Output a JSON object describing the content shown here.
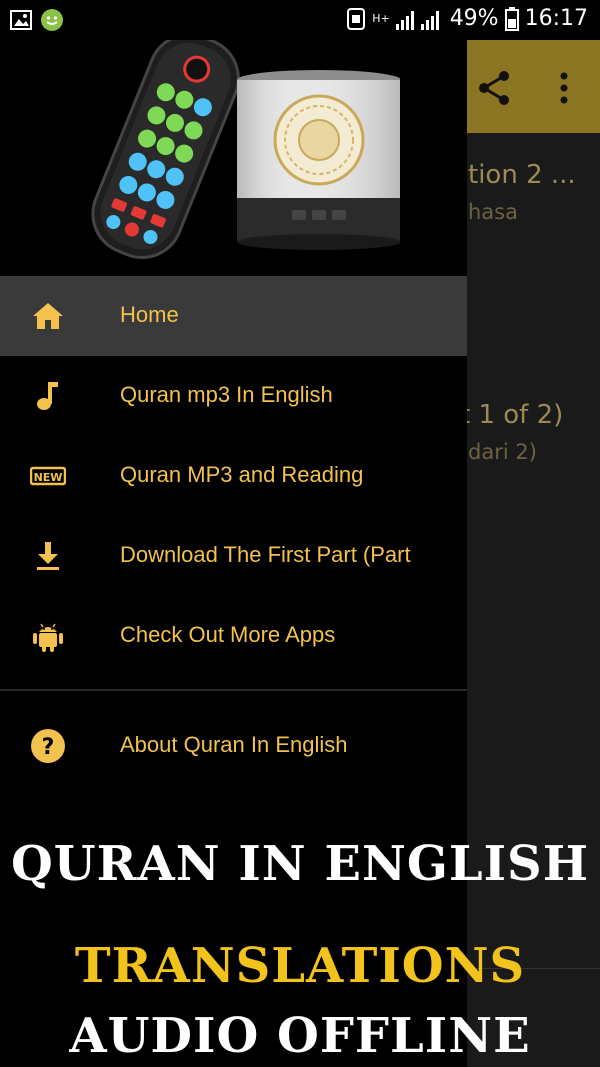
{
  "status_bar": {
    "network_type": "H+",
    "battery_percent": "49%",
    "time": "16:17",
    "icons": [
      "gallery-icon",
      "android-notification-icon",
      "nfc-icon",
      "signal-icon",
      "battery-icon"
    ]
  },
  "background_screen": {
    "toolbar_color": "#8c7522",
    "line1": "tion 2 ...",
    "line2": "hasa",
    "line3": "t 1 of 2)",
    "line4": "dari 2)"
  },
  "drawer": {
    "items": [
      {
        "label": "Home",
        "icon": "home-icon",
        "active": true
      },
      {
        "label": "Quran mp3 In English",
        "icon": "music-note-icon",
        "active": false
      },
      {
        "label": "Quran MP3 and Reading",
        "icon": "new-badge-icon",
        "active": false
      },
      {
        "label": "Download The First Part (Part",
        "icon": "download-icon",
        "active": false
      },
      {
        "label": "Check Out More Apps",
        "icon": "android-icon",
        "active": false
      }
    ],
    "secondary_items": [
      {
        "label": "About Quran In English",
        "icon": "help-icon"
      }
    ],
    "accent_color": "#f2c14e"
  },
  "promo": {
    "line1": "QURAN IN ENGLISH",
    "line2": "TRANSLATIONS",
    "line3": "AUDIO OFFLINE"
  }
}
